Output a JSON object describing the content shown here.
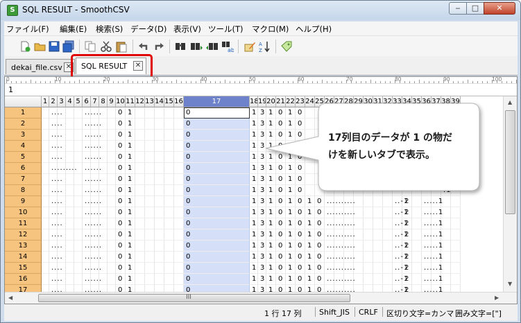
{
  "window": {
    "title": "SQL RESULT - SmoothCSV",
    "icon_letter": "S",
    "min": "‒",
    "max": "□",
    "close": "✕"
  },
  "menu": [
    "ファイル(F)",
    "編集(E)",
    "検索(S)",
    "データ(D)",
    "表示(V)",
    "ツール(T)",
    "マクロ(M)",
    "ヘルプ(H)"
  ],
  "tabs": [
    {
      "label": "dekai_file.csv",
      "close": "✕"
    },
    {
      "label": "SQL RESULT",
      "close": "✕"
    }
  ],
  "editor": {
    "value": "1"
  },
  "ruler": [
    "0",
    "10",
    "20",
    "30",
    "40",
    "50",
    "60",
    "70",
    "80",
    "90",
    "100",
    "1"
  ],
  "columns": [
    "1",
    "2",
    "3",
    "4",
    "5",
    "6",
    "7",
    "8",
    "9",
    "10",
    "11",
    "12",
    "13",
    "14",
    "15",
    "16",
    "17",
    "18",
    "19",
    "20",
    "21",
    "22",
    "23",
    "24",
    "25",
    "26",
    "27",
    "28",
    "29",
    "30",
    "31",
    "32",
    "33",
    "34",
    "35",
    "36",
    "37",
    "38",
    "39"
  ],
  "selected_column": "17",
  "rows": [
    [
      "1",
      "",
      "....",
      "",
      "......",
      "0",
      "1",
      "",
      "",
      "",
      "0",
      "1",
      "3",
      "1",
      "0",
      "1",
      "0",
      "",
      "",
      "",
      "",
      "",
      "",
      "",
      "",
      "",
      "",
      "",
      "",
      ".1"
    ],
    [
      "2",
      "",
      "....",
      "",
      "......",
      "0",
      "1",
      "",
      "",
      "",
      "0",
      "1",
      "3",
      "1",
      "0",
      "1",
      "0",
      "",
      "",
      "",
      "",
      "",
      "",
      "",
      "",
      "",
      "",
      "",
      "",
      ".1"
    ],
    [
      "3",
      "",
      "....",
      "",
      "......",
      "0",
      "1",
      "",
      "",
      "",
      "0",
      "1",
      "3",
      "1",
      "0",
      "1",
      "0",
      "",
      "",
      "",
      "",
      "",
      "",
      "",
      "",
      "",
      "",
      "",
      "",
      ".1"
    ],
    [
      "4",
      "",
      "....",
      "",
      "......",
      "0",
      "1",
      "",
      "",
      "",
      "0",
      "1",
      "3",
      "1",
      "0",
      "1",
      "0",
      "",
      "",
      "",
      "",
      "",
      "",
      "",
      "",
      "",
      "",
      "",
      "",
      ".1"
    ],
    [
      "5",
      "",
      "....",
      "",
      "......",
      "0",
      "1",
      "",
      "",
      "",
      "0",
      "1",
      "3",
      "1",
      "0",
      "1",
      "0",
      "",
      "",
      "",
      "",
      "",
      "",
      "",
      "",
      "",
      "",
      "",
      "",
      ".1"
    ],
    [
      "6",
      "",
      ".........",
      "",
      "......",
      "0",
      "1",
      "",
      "",
      "",
      "0",
      "1",
      "3",
      "1",
      "0",
      "1",
      "0",
      "",
      "",
      "",
      "",
      "",
      "",
      "",
      "",
      "",
      "",
      "",
      "",
      ".1"
    ],
    [
      "7",
      "",
      "....",
      "",
      "......",
      "0",
      "1",
      "",
      "",
      "",
      "0",
      "1",
      "3",
      "1",
      "0",
      "1",
      "0",
      "",
      "",
      "",
      "",
      "",
      "",
      "",
      "",
      "",
      "",
      "",
      "",
      ".1"
    ],
    [
      "8",
      "",
      "....",
      "",
      "......",
      "0",
      "1",
      "",
      "",
      "",
      "0",
      "1",
      "3",
      "1",
      "0",
      "1",
      "0",
      "",
      "",
      "",
      "",
      "",
      "",
      "",
      "",
      "",
      "",
      "",
      "",
      ".1"
    ],
    [
      "9",
      "",
      "....",
      "",
      "......",
      "0",
      "1",
      "",
      "",
      "",
      "0",
      "1",
      "3",
      "1",
      "0",
      "1",
      "0",
      "1",
      "0",
      "..........",
      "",
      "..-1",
      "2",
      "",
      ".....1"
    ],
    [
      "10",
      "",
      "....",
      "",
      "......",
      "0",
      "1",
      "",
      "",
      "",
      "0",
      "1",
      "3",
      "1",
      "0",
      "1",
      "0",
      "1",
      "0",
      "..........",
      "",
      "..-1",
      "2",
      "",
      ".....1"
    ],
    [
      "11",
      "",
      "....",
      "",
      "......",
      "0",
      "1",
      "",
      "",
      "",
      "0",
      "1",
      "3",
      "1",
      "0",
      "1",
      "0",
      "1",
      "0",
      "..........",
      "",
      "..-1",
      "2",
      "",
      ".....1"
    ],
    [
      "12",
      "",
      "....",
      "",
      "......",
      "0",
      "1",
      "",
      "",
      "",
      "0",
      "1",
      "3",
      "1",
      "0",
      "1",
      "0",
      "1",
      "0",
      "..........",
      "",
      "..-1",
      "2",
      "",
      ".....1"
    ],
    [
      "13",
      "",
      "....",
      "",
      "......",
      "0",
      "1",
      "",
      "",
      "",
      "0",
      "1",
      "3",
      "1",
      "0",
      "1",
      "0",
      "1",
      "0",
      "..........",
      "",
      "..-1",
      "2",
      "",
      ".....1"
    ],
    [
      "14",
      "",
      "....",
      "",
      "......",
      "0",
      "1",
      "",
      "",
      "",
      "0",
      "1",
      "3",
      "1",
      "0",
      "1",
      "0",
      "1",
      "0",
      "..........",
      "",
      "..-1",
      "2",
      "",
      ".....1"
    ],
    [
      "15",
      "",
      "....",
      "",
      "......",
      "0",
      "1",
      "",
      "",
      "",
      "0",
      "1",
      "3",
      "1",
      "0",
      "1",
      "0",
      "1",
      "0",
      "..........",
      "",
      "..-1",
      "2",
      "",
      ".....1"
    ],
    [
      "16",
      "",
      "....",
      "",
      "......",
      "0",
      "1",
      "",
      "",
      "",
      "0",
      "1",
      "3",
      "1",
      "0",
      "1",
      "0",
      "1",
      "0",
      "..........",
      "",
      "..-1",
      "2",
      "",
      ".....1"
    ],
    [
      "17",
      "",
      "....",
      "",
      "......",
      "0",
      "1",
      "",
      "",
      "",
      "0",
      "1",
      "3",
      "1",
      "0",
      "1",
      "0",
      "1",
      "0",
      "..........",
      "",
      "..-1",
      "2",
      "",
      ".....1"
    ]
  ],
  "hscroll_grip": "III",
  "status": {
    "position": "1 行 17 列",
    "encoding": "Shift_JIS",
    "newline": "CRLF",
    "delimiter": "区切り文字=カンマ",
    "quote": "囲み文字=[\"]"
  },
  "callout": {
    "line1": "17列目のデータが 1 の物だ",
    "line2": "けを新しいタブで表示。"
  },
  "colors": {
    "highlight": "#e10000",
    "selected_header": "#6e82cc",
    "selected_column": "#d5dff8",
    "row_header": "#f6c47f"
  }
}
